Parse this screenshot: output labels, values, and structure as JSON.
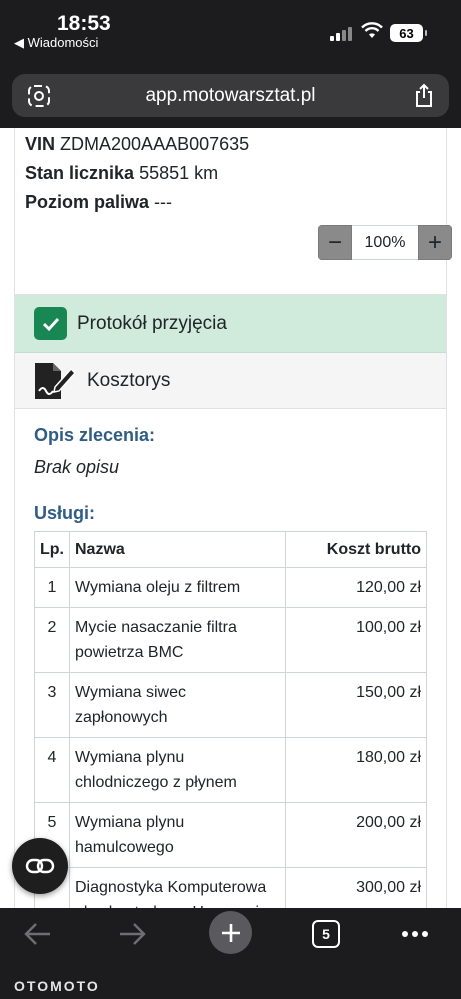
{
  "status_bar": {
    "time": "18:53",
    "back_app": "◀ Wiadomości",
    "battery": "63"
  },
  "browser": {
    "url": "app.motowarsztat.pl",
    "tabs_count": "5"
  },
  "vehicle": {
    "vin_label": "VIN",
    "vin_value": "ZDMA200AAAB007635",
    "odometer_label": "Stan licznika",
    "odometer_value": "55851 km",
    "fuel_label": "Poziom paliwa",
    "fuel_value": "---"
  },
  "zoom": {
    "minus": "−",
    "value": "100%",
    "plus": "+"
  },
  "sections": {
    "protocol": "Protokół przyjęcia",
    "estimate": "Kosztorys"
  },
  "order": {
    "description_label": "Opis zlecenia:",
    "description_value": "Brak opisu",
    "services_label": "Usługi:"
  },
  "services_table": {
    "headers": {
      "lp": "Lp.",
      "name": "Nazwa",
      "cost": "Koszt brutto"
    },
    "rows": [
      {
        "lp": "1",
        "name": "Wymiana oleju z filtrem",
        "cost": "120,00 zł"
      },
      {
        "lp": "2",
        "name": "Mycie nasaczanie filtra powietrza BMC",
        "cost": "100,00 zł"
      },
      {
        "lp": "3",
        "name": "Wymiana siwec zapłonowych",
        "cost": "150,00 zł"
      },
      {
        "lp": "4",
        "name": "Wymiana plynu chlodniczego z płynem",
        "cost": "180,00 zł"
      },
      {
        "lp": "5",
        "name": "Wymiana plynu hamulcowego",
        "cost": "200,00 zł"
      },
      {
        "lp": "",
        "name": "Diagnostyka Komputerowa plus kontrola na Hamowni",
        "cost": "300,00 zł"
      }
    ]
  },
  "watermark": "OTOMOTO",
  "colors": {
    "accent_green": "#198754",
    "protocol_bg": "#d0eadb",
    "label_blue": "#2f5d86"
  }
}
